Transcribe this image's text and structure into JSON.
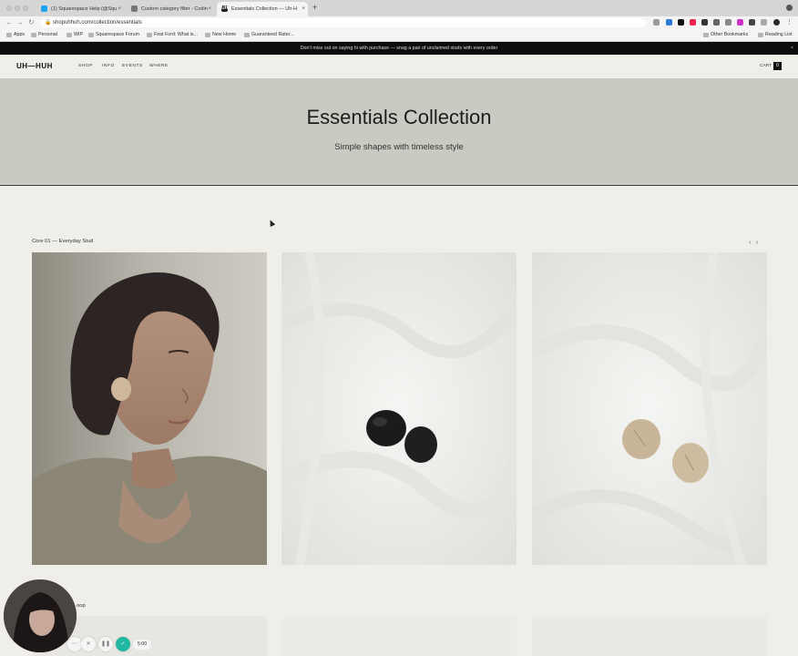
{
  "browser": {
    "tabs": [
      {
        "title": "(1) Squarespace Help (@Squ",
        "favicon": "bird-icon",
        "color": "#1da1f2"
      },
      {
        "title": "Custom category filter - Codin",
        "favicon": "gear-icon",
        "color": "#555555"
      },
      {
        "title": "Essentials Collection — Uh-H",
        "favicon": "UH",
        "color": "#222222"
      }
    ],
    "url": "shopuhhuh.com/collection/essentials",
    "bookmarks": [
      "Apps",
      "Personal",
      "WIP",
      "Squarespace Forum",
      "Feat Ford: What is...",
      "New Home",
      "Guaranteed Rater...",
      "Other Bookmarks",
      "Reading List"
    ]
  },
  "announcement": {
    "text": "Don't miss out on saying hi with purchase — snag a pair of unclaimed studs with every order",
    "close": "×"
  },
  "site": {
    "logo": "UH—HUH",
    "nav": [
      "SHOP",
      "INFO",
      "EVENTS",
      "WHERE"
    ],
    "cart_label": "CART",
    "cart_count": "0"
  },
  "hero": {
    "title": "Essentials Collection",
    "subtitle": "Simple shapes with timeless style"
  },
  "section1": {
    "title": "Core 01 — Everyday Stud",
    "prev": "‹",
    "next": "›"
  },
  "section2": {
    "title": "oop"
  },
  "recorder": {
    "timer": "5:00"
  },
  "colors": {
    "page_bg": "#efeee8",
    "hero_bg": "#cbcac2",
    "announcement_bg": "#0d0d0d",
    "recorder_accent": "#20b8a0"
  }
}
